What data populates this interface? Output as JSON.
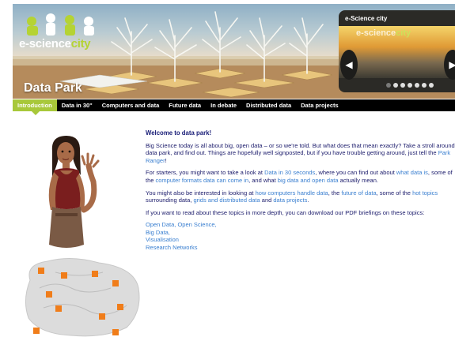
{
  "banner": {
    "logo_main": "e-science",
    "logo_accent": "city",
    "park_title": "Data Park"
  },
  "slideshow": {
    "title": "e-Science city",
    "logo_main": "e-science",
    "logo_accent": "city",
    "prev_icon": "◀",
    "next_icon": "▶",
    "dot_count": 7,
    "active_dot": 1
  },
  "nav": {
    "items": [
      {
        "label": "Introduction",
        "active": true
      },
      {
        "label": "Data in 30\"",
        "active": false
      },
      {
        "label": "Computers and data",
        "active": false
      },
      {
        "label": "Future data",
        "active": false
      },
      {
        "label": "In debate",
        "active": false
      },
      {
        "label": "Distributed data",
        "active": false
      },
      {
        "label": "Data projects",
        "active": false
      }
    ]
  },
  "content": {
    "heading": "Welcome to data park!",
    "p1_text": "Big Science today is all about big, open data – or so we're told. But what does that mean exactly? Take a stroll around data park, and find out. Things are hopefully well signposted, but if you have trouble getting around, just tell the ",
    "p1_link": "Park Ranger",
    "p1_end": "!",
    "p2": {
      "t1": "For starters, you might want to take a look at ",
      "l1": "Data in 30 seconds",
      "t2": ", where you can find out about ",
      "l2": "what data is",
      "t3": ", some of the ",
      "l3": "computer formats data can come in",
      "t4": ", and what ",
      "l4": "big data and open data",
      "t5": " actually mean."
    },
    "p3": {
      "t1": "You might also be interested in looking at ",
      "l1": "how computers handle data",
      "t2": ", the ",
      "l2": "future of data",
      "t3": ", some of the ",
      "l3": "hot topics",
      "t4": " surrounding data, ",
      "l4": "grids and distributed data",
      "t5": " and ",
      "l5": "data projects",
      "t6": "."
    },
    "p4": "If you want to read about these topics in more depth, you can download our PDF briefings on these topics:",
    "briefings": [
      "Open Data, Open Science,",
      "Big Data,",
      "Visualisation",
      "Research Networks"
    ]
  },
  "colors": {
    "nav_active": "#a8c83a",
    "link": "#3a7fd0",
    "text": "#1b1b6b",
    "map_marker": "#f07d1a"
  }
}
